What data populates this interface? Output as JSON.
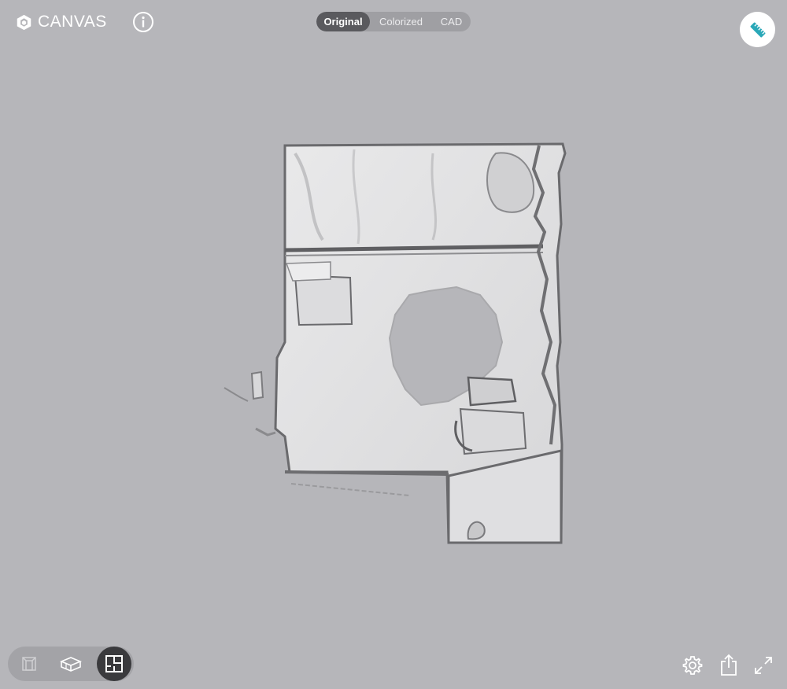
{
  "app": {
    "brand_name": "CANVAS",
    "brand_icon": "canvas-cube-logo"
  },
  "header": {
    "info_icon": "info-icon",
    "mode_tabs": [
      {
        "label": "Original",
        "active": true
      },
      {
        "label": "Colorized",
        "active": false
      },
      {
        "label": "CAD",
        "active": false
      }
    ],
    "measure_icon": "ruler-icon"
  },
  "viewer": {
    "model_description_icon": "3d-scan-model"
  },
  "bottom_bar": {
    "view_modes": [
      {
        "icon": "first-person-view-icon",
        "active": false
      },
      {
        "icon": "isometric-3d-view-icon",
        "active": false
      },
      {
        "icon": "floor-plan-view-icon",
        "active": true
      }
    ],
    "tools": [
      {
        "icon": "gear-icon"
      },
      {
        "icon": "share-icon"
      },
      {
        "icon": "fullscreen-icon"
      }
    ]
  },
  "colors": {
    "background": "#b6b6ba",
    "accent": "#2aa8b8",
    "active_tab": "#5a5a5e"
  }
}
